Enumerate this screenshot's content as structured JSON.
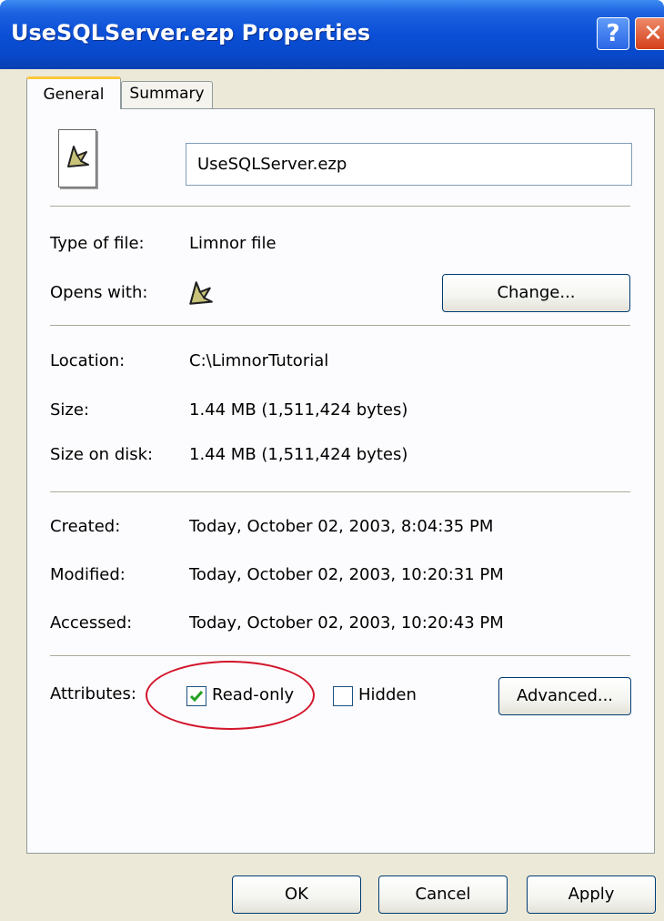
{
  "window": {
    "title": "UseSQLServer.ezp Properties",
    "help_label": "?",
    "close_label": "✕"
  },
  "tabs": [
    {
      "label": "General",
      "active": true
    },
    {
      "label": "Summary",
      "active": false
    }
  ],
  "general": {
    "filename": "UseSQLServer.ezp",
    "type_label": "Type of file:",
    "type_value": "Limnor file",
    "opens_label": "Opens with:",
    "change_button": "Change...",
    "location_label": "Location:",
    "location_value": "C:\\LimnorTutorial",
    "size_label": "Size:",
    "size_value": "1.44 MB (1,511,424 bytes)",
    "size_disk_label": "Size on disk:",
    "size_disk_value": "1.44 MB (1,511,424 bytes)",
    "created_label": "Created:",
    "created_value": "Today, October 02, 2003, 8:04:35 PM",
    "modified_label": "Modified:",
    "modified_value": "Today, October 02, 2003, 10:20:31 PM",
    "accessed_label": "Accessed:",
    "accessed_value": "Today, October 02, 2003, 10:20:43 PM",
    "attributes_label": "Attributes:",
    "readonly_label": "Read-only",
    "readonly_checked": true,
    "hidden_label": "Hidden",
    "hidden_checked": false,
    "advanced_button": "Advanced..."
  },
  "footer": {
    "ok": "OK",
    "cancel": "Cancel",
    "apply": "Apply"
  },
  "colors": {
    "titlebar": "#0a4fd6",
    "dialog_bg": "#ece9d8",
    "annotation_ellipse": "#d2142a",
    "checkmark": "#21a121"
  }
}
